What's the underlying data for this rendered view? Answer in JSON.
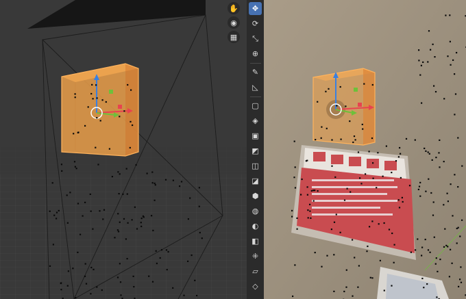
{
  "app": "3D viewport (camera tracking scene)",
  "colors": {
    "active_tool": "#4772b3",
    "selection_orange": "#f0a24a",
    "axis_x": "#e8434f",
    "axis_y": "#6ec03a",
    "axis_z": "#3a80e0"
  },
  "nav_gizmo": {
    "buttons": [
      "hand-pan-icon",
      "camera-icon",
      "grid-icon"
    ]
  },
  "toolbar": {
    "tools": [
      "move-tool-icon",
      "rotate-tool-icon",
      "scale-tool-icon",
      "transform-tool-icon",
      "annotate-tool-icon",
      "measure-tool-icon",
      "add-cube-tool-icon",
      "extrude-region-tool-icon",
      "inset-faces-tool-icon",
      "bevel-tool-icon",
      "loop-cut-tool-icon",
      "knife-tool-icon",
      "poly-build-tool-icon",
      "spin-tool-icon",
      "smooth-tool-icon",
      "edge-slide-tool-icon",
      "shrink-fatten-tool-icon",
      "shear-tool-icon",
      "rip-region-tool-icon"
    ],
    "active_tool": "move-tool-icon"
  },
  "left_viewport": {
    "description": "perspective view with camera frustum, cube and track points"
  },
  "right_viewport": {
    "description": "camera view over background footage with tracked cube"
  }
}
